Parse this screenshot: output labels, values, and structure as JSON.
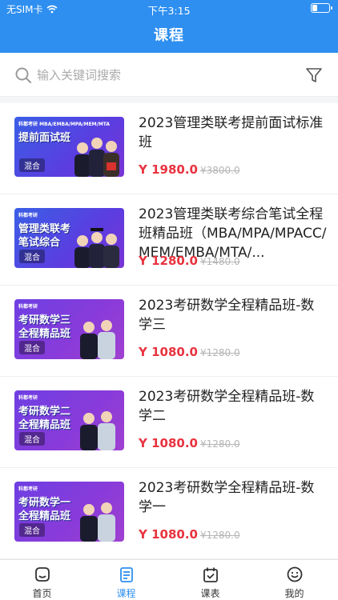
{
  "status_bar": {
    "carrier": "无SIM卡",
    "time": "下午3:15"
  },
  "header": {
    "title": "课程"
  },
  "search": {
    "placeholder": "输入关键词搜索"
  },
  "courses": [
    {
      "title": "2023管理类联考提前面试标准班",
      "price": "Y 1980.0",
      "old_price": "¥3800.0",
      "thumb": {
        "brand": "科都考研 MBA/EMBA/MPA/MEM/MTA",
        "line1": "提前面试班",
        "line2": "",
        "badge": "混合",
        "color": "blue"
      }
    },
    {
      "title": "2023管理类联考综合笔试全程班精品班（MBA/MPA/MPACC/MEM/EMBA/MTA/...",
      "price": "Y 1280.0",
      "old_price": "¥1480.0",
      "thumb": {
        "brand": "科都考研",
        "line1": "管理类联考",
        "line2": "笔试综合",
        "badge": "混合",
        "color": "blue"
      }
    },
    {
      "title": "2023考研数学全程精品班-数学三",
      "price": "Y 1080.0",
      "old_price": "¥1280.0",
      "thumb": {
        "brand": "科都考研",
        "line1": "考研数学三",
        "line2": "全程精品班",
        "badge": "混合",
        "color": "purple"
      }
    },
    {
      "title": "2023考研数学全程精品班-数学二",
      "price": "Y 1080.0",
      "old_price": "¥1280.0",
      "thumb": {
        "brand": "科都考研",
        "line1": "考研数学二",
        "line2": "全程精品班",
        "badge": "混合",
        "color": "purple"
      }
    },
    {
      "title": "2023考研数学全程精品班-数学一",
      "price": "Y 1080.0",
      "old_price": "¥1280.0",
      "thumb": {
        "brand": "科都考研",
        "line1": "考研数学一",
        "line2": "全程精品班",
        "badge": "混合",
        "color": "purple"
      }
    }
  ],
  "tabbar": {
    "items": [
      {
        "label": "首页",
        "icon": "home-icon"
      },
      {
        "label": "课程",
        "icon": "course-icon",
        "active": true
      },
      {
        "label": "课表",
        "icon": "schedule-icon"
      },
      {
        "label": "我的",
        "icon": "profile-icon"
      }
    ]
  },
  "colors": {
    "accent": "#2e8ff0",
    "price": "#e8333f"
  }
}
